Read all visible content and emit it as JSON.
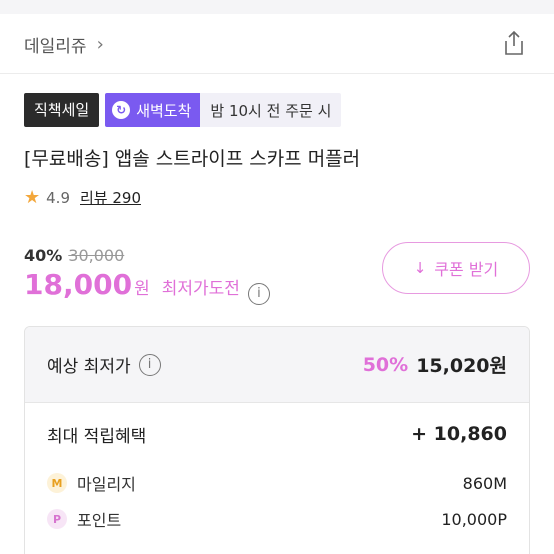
{
  "header": {
    "breadcrumb": "데일리쥬",
    "chevron": "›",
    "share_icon": "share-icon"
  },
  "badges": {
    "direct": "직책세일",
    "dawn": "새벽도착",
    "dawn_note": "밤 10시 전 주문 시"
  },
  "product": {
    "title": "[무료배송] 앱솔 스트라이프 스카프 머플러",
    "rating": "4.9",
    "review": "리뷰 290"
  },
  "price": {
    "discount_pct": "40%",
    "original": "30,000",
    "sale": "18,000",
    "won": "원",
    "challenge": "최저가도전",
    "info": "i"
  },
  "coupon": {
    "label": "쿠폰 받기",
    "icon": "download-icon"
  },
  "panel": {
    "expected_label": "예상 최저가",
    "expected_pct": "50%",
    "expected_price": "15,020원",
    "benefit_label": "최대 적립혜택",
    "benefit_value": "+ 10,860",
    "items": [
      {
        "icon": "M",
        "label": "마일리지",
        "value": "860M"
      },
      {
        "icon": "P",
        "label": "포인트",
        "value": "10,000P"
      }
    ]
  },
  "colors": {
    "accent": "#e070d8",
    "dawn": "#7a5af0",
    "dark_badge": "#2b2b2b",
    "star": "#f3a73b"
  }
}
